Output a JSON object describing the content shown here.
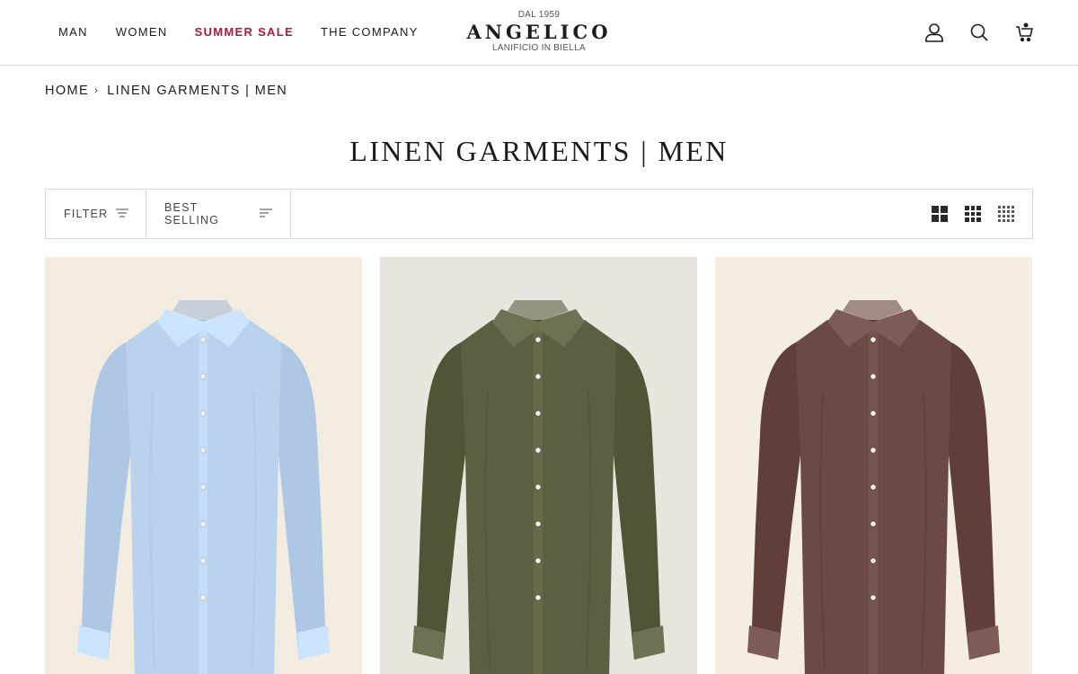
{
  "nav": {
    "items": [
      {
        "label": "MAN"
      },
      {
        "label": "WOMEN"
      },
      {
        "label": "SUMMER SALE"
      },
      {
        "label": "THE COMPANY"
      }
    ]
  },
  "logo": {
    "since": "DAL 1959",
    "brand": "ANGELICO",
    "tagline": "LANIFICIO IN BIELLA"
  },
  "header_icons": [
    "account-icon",
    "search-icon",
    "cart-icon"
  ],
  "breadcrumb": {
    "home": "HOME",
    "separator": "›",
    "current": "LINEN GARMENTS | MEN"
  },
  "page_title": "LINEN GARMENTS | MEN",
  "toolbar": {
    "filter_label": "FILTER",
    "sort_label": "BEST SELLING"
  },
  "products": [
    {
      "color": "#b9d2ee",
      "background": "#f2ece1"
    },
    {
      "color": "#5d6040",
      "background": "#e8e6df"
    },
    {
      "color": "#6b4a45",
      "background": "#f3ede2"
    }
  ],
  "colors": {
    "accent_sale": "#b5163b",
    "text": "#1c1b1b",
    "border": "#d9d9d9"
  }
}
